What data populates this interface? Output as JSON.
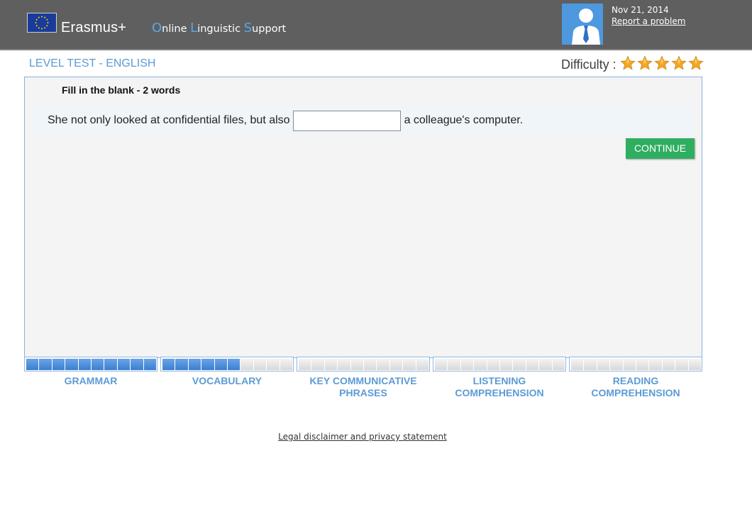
{
  "header": {
    "brand_erasmus": "Erasmus+",
    "brand_ols_parts": [
      {
        "cap": "O",
        "rest": "nline "
      },
      {
        "cap": "L",
        "rest": "inguistic "
      },
      {
        "cap": "S",
        "rest": "upport"
      }
    ],
    "date": "Nov 21, 2014",
    "report_link": "Report a problem",
    "icons": {
      "flag": "eu-flag-icon",
      "avatar": "user-avatar-icon"
    }
  },
  "test": {
    "title": "LEVEL TEST - ENGLISH",
    "difficulty_label": "Difficulty :",
    "difficulty_stars": 5,
    "difficulty_max": 5
  },
  "question": {
    "instruction": "Fill in the blank - 2 words",
    "sentence_before": "She not only looked at confidential files, but also",
    "sentence_after": "a colleague's computer.",
    "answer_value": "",
    "continue_label": "CONTINUE"
  },
  "sections": [
    {
      "label_lines": [
        "GRAMMAR"
      ],
      "progress": 1.0
    },
    {
      "label_lines": [
        "VOCABULARY"
      ],
      "progress": 0.6
    },
    {
      "label_lines": [
        "KEY COMMUNICATIVE",
        "PHRASES"
      ],
      "progress": 0.0
    },
    {
      "label_lines": [
        "LISTENING",
        "COMPREHENSION"
      ],
      "progress": 0.0
    },
    {
      "label_lines": [
        "READING",
        "COMPREHENSION"
      ],
      "progress": 0.0
    }
  ],
  "footer": {
    "legal_link": "Legal disclaimer and privacy statement"
  },
  "colors": {
    "header_bg": "#5f5f5f",
    "accent_blue": "#5b9bd5",
    "continue_green": "#2fae62",
    "star_gold": "#f5a623"
  }
}
